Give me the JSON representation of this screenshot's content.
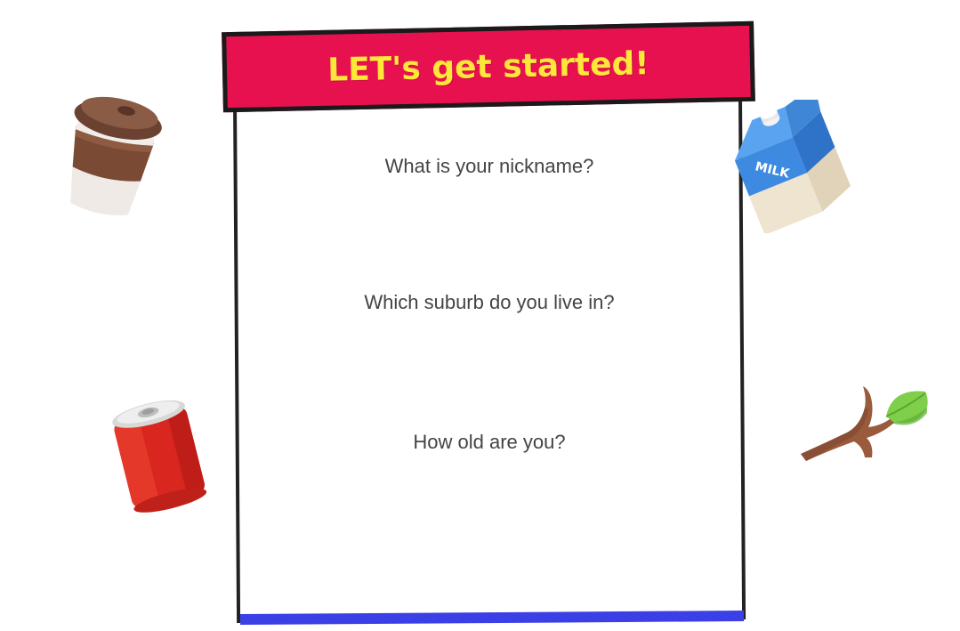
{
  "banner": {
    "title": "LET's get started!"
  },
  "questions": [
    {
      "label": "What is your nickname?"
    },
    {
      "label": "Which suburb do you live in?"
    },
    {
      "label": "How old are you?"
    }
  ],
  "decorations": {
    "coffee_cup": {
      "icon": "coffee-cup-icon"
    },
    "milk_carton": {
      "icon": "milk-carton-icon",
      "text": "MILK"
    },
    "soda_can": {
      "icon": "soda-can-icon"
    },
    "branch": {
      "icon": "branch-leaf-icon"
    }
  },
  "colors": {
    "banner_bg": "#e8114f",
    "banner_text": "#ffe63a",
    "frame": "#222222",
    "bottom_bar": "#3b3fe6",
    "question_text": "#444444"
  }
}
